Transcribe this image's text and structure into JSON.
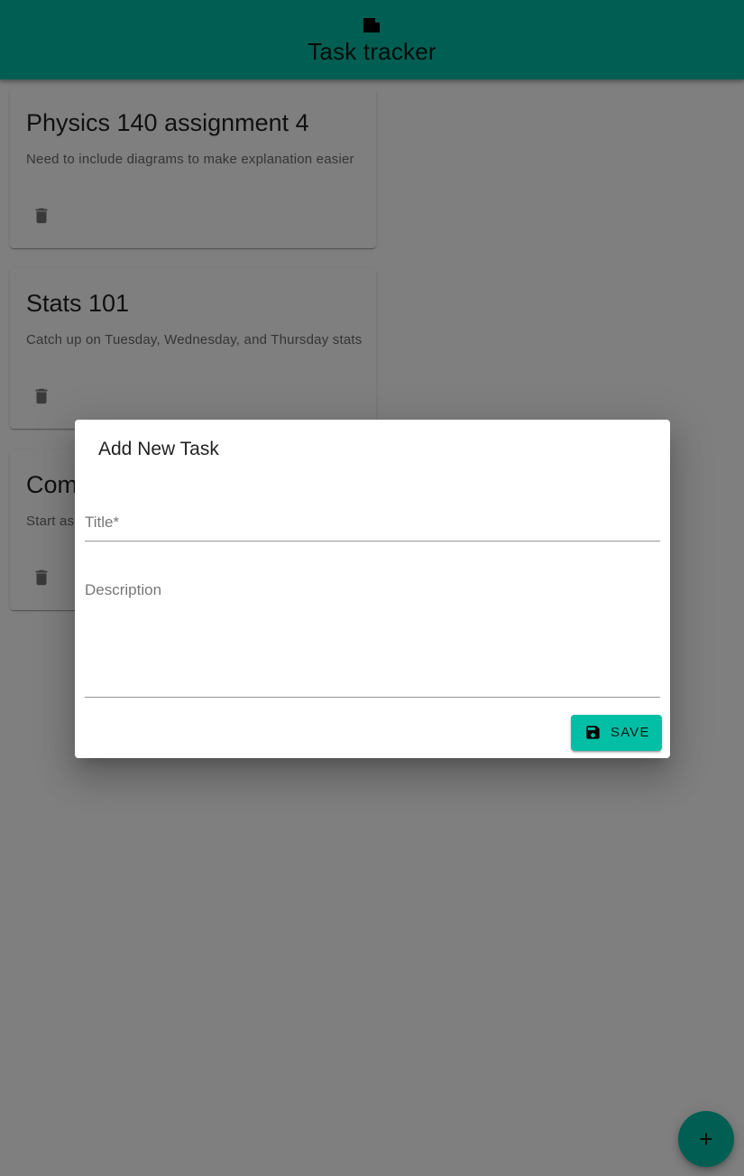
{
  "app": {
    "title": "Task tracker",
    "logo_icon": "note-icon",
    "accent_color": "#00bfa5"
  },
  "tasks": [
    {
      "title": "Physics 140 assignment 4",
      "description": "Need to include diagrams to make explanation easier",
      "delete_icon": "trash-icon"
    },
    {
      "title": "Stats 101",
      "description": "Catch up on Tuesday, Wednesday, and Thursday stats",
      "delete_icon": "trash-icon"
    },
    {
      "title": "Com",
      "description": "Start as",
      "delete_icon": "trash-icon"
    }
  ],
  "dialog": {
    "title": "Add New Task",
    "title_field": {
      "placeholder": "Title*",
      "value": ""
    },
    "description_field": {
      "placeholder": "Description",
      "value": ""
    },
    "save_button": {
      "label": "SAVE",
      "icon": "floppy-disk-icon"
    }
  },
  "fab": {
    "icon": "plus-icon"
  }
}
